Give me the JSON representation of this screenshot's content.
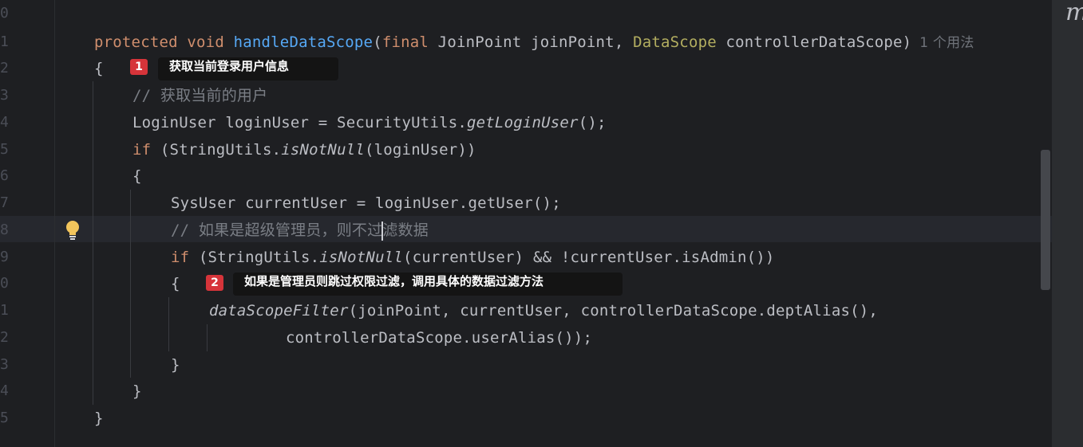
{
  "editor": {
    "line_numbers": [
      "0",
      "1",
      "2",
      "3",
      "4",
      "5",
      "6",
      "7",
      "8",
      "9",
      "0",
      "1",
      "2",
      "3",
      "4",
      "5"
    ],
    "lines": {
      "l1": {
        "kw1": "protected",
        "kw2": "void",
        "method": "handleDataScope",
        "open": "(",
        "kw3": "final",
        "p1": " JoinPoint joinPoint, ",
        "anno": "DataScope",
        "p2": " controllerDataScope)",
        "usage_hint": "1 个用法"
      },
      "l2": "{",
      "l3": "// 获取当前的用户",
      "l4": {
        "a": "LoginUser loginUser = SecurityUtils.",
        "b": "getLoginUser",
        "c": "();"
      },
      "l5": {
        "kw": "if",
        "a": " (StringUtils.",
        "b": "isNotNull",
        "c": "(loginUser))"
      },
      "l6": "{",
      "l7": "SysUser currentUser = loginUser.getUser();",
      "l8": {
        "a": "// 如果是超级管理员，则不过",
        "b": "滤数据"
      },
      "l9": {
        "kw": "if",
        "a": " (StringUtils.",
        "b": "isNotNull",
        "c": "(currentUser) && !currentUser.isAdmin())"
      },
      "l10": "{",
      "l11": {
        "a": "dataScopeFilter",
        "b": "(joinPoint, currentUser, controllerDataScope.deptAlias(),"
      },
      "l12": "controllerDataScope.userAlias());",
      "l13": "}",
      "l14": "}",
      "l15": "}"
    },
    "corner_text": "m"
  },
  "annotations": [
    {
      "num": "1",
      "text": "获取当前登录用户信息"
    },
    {
      "num": "2",
      "text": "如果是管理员则跳过权限过滤，调用具体的数据过滤方法"
    }
  ],
  "colors": {
    "background": "#1e1f22",
    "keyword": "#cf8e6d",
    "method_decl": "#56a8f5",
    "annotation": "#b3ae60",
    "comment": "#7a7e85",
    "badge": "#d6343a"
  },
  "icons": {
    "intention": "lightbulb-icon"
  }
}
